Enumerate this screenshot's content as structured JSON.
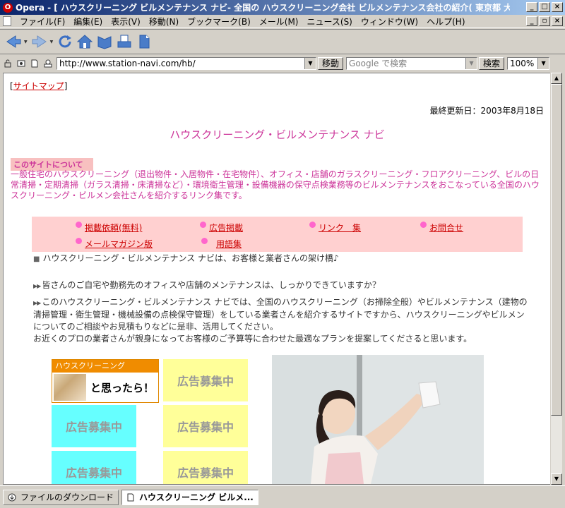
{
  "window": {
    "title": "Opera - [ ハウスクリーニング ビルメンテナンス ナビ- 全国の ハウスクリーニング会社 ビルメンテナンス会社の紹介( 東京都 大阪府 など) ]"
  },
  "menu": {
    "items": [
      "ファイル(F)",
      "編集(E)",
      "表示(V)",
      "移動(N)",
      "ブックマーク(B)",
      "メール(M)",
      "ニュース(S)",
      "ウィンドウ(W)",
      "ヘルプ(H)"
    ]
  },
  "toolbar": {
    "icons": [
      "back-icon",
      "forward-icon",
      "reload-icon",
      "home-icon",
      "hotlist-icon",
      "print-icon",
      "page-icon"
    ]
  },
  "address": {
    "url": "http://www.station-navi.com/hb/",
    "go_label": "移動",
    "search_placeholder": "Google で検索",
    "search_label": "検索",
    "zoom": "100%"
  },
  "page": {
    "sitemap_pre": "[",
    "sitemap": "サイトマップ",
    "sitemap_post": "]",
    "updated": "最終更新日：2003年8月18日",
    "title": "ハウスクリーニング・ビルメンテナンス ナビ",
    "about_label": "このサイトについて",
    "about_text": "一般住宅のハウスクリーニング（退出物件・入居物件・在宅物件）、オフィス・店舗のガラスクリーニング・フロアクリーニング、ビルの日常清掃・定期清掃（ガラス清掃・床清掃など）・環境衛生管理・設備機器の保守点検業務等のビルメンテナンスをおこなっている全国のハウスクリーニング・ビルメン会社さんを紹介するリンク集です。",
    "nav": {
      "request": "掲載依頼(無料)",
      "ads": "広告掲載",
      "links": "リンク　集",
      "contact": "お問合せ",
      "magazine": "メールマガジン版",
      "glossary": "用語集"
    },
    "intro": "ハウスクリーニング・ビルメンテナンス ナビは、お客様と業者さんの架け橋♪",
    "para1": "皆さんのご自宅や勤務先のオフィスや店舗のメンテナンスは、しっかりできていますか？",
    "para2": "このハウスクリーニング・ビルメンテナンス ナビでは、全国のハウスクリーニング（お掃除全般）やビルメンテナンス（建物の清掃管理・衛生管理・機械設備の点検保守管理）をしている業者さんを紹介するサイトですから、ハウスクリーニングやビルメンについてのご相談やお見積もりなどに是非、活用してください。",
    "para3": "お近くのプロの業者さんが親身になってお客様のご予算等に合わせた最適なプランを提案してくださると思います。",
    "ad_banner_header": "ハウスクリーニング",
    "ad_banner_catch": "と思ったら！",
    "ad_placeholder": "広告募集中"
  },
  "status": {
    "downloads": "ファイルのダウンロード",
    "tab": "ハウスクリーニング ビルメ..."
  }
}
